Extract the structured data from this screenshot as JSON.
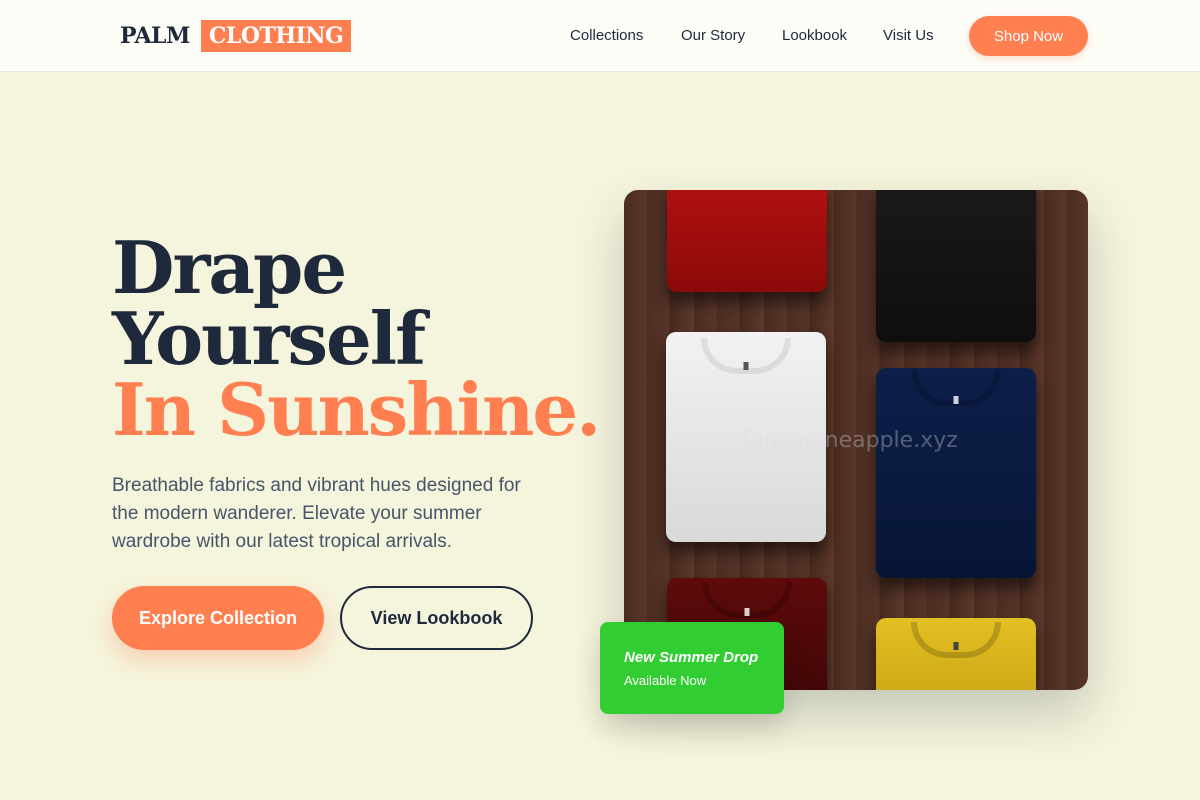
{
  "header": {
    "logo_primary": "PALM",
    "logo_secondary": "CLOTHING",
    "nav": [
      "Collections",
      "Our Story",
      "Lookbook",
      "Visit Us"
    ],
    "cta_label": "Shop Now"
  },
  "hero": {
    "headline_line1": "Drape",
    "headline_line2": "Yourself",
    "headline_accent": "In Sunshine.",
    "description": "Breathable fabrics and vibrant hues designed for the modern wanderer. Elevate your summer wardrobe with our latest tropical arrivals.",
    "primary_button": "Explore Collection",
    "secondary_button": "View Lookbook"
  },
  "image": {
    "watermark": "funnypineapple.xyz",
    "shirt_colors": [
      "red",
      "black",
      "white",
      "navy",
      "maroon",
      "yellow"
    ]
  },
  "badge": {
    "title": "New Summer Drop",
    "subtitle": "Available Now"
  },
  "colors": {
    "accent": "#ff7f50",
    "dark": "#1e293b",
    "background": "#f5f4dc",
    "badge": "#32cd32"
  }
}
